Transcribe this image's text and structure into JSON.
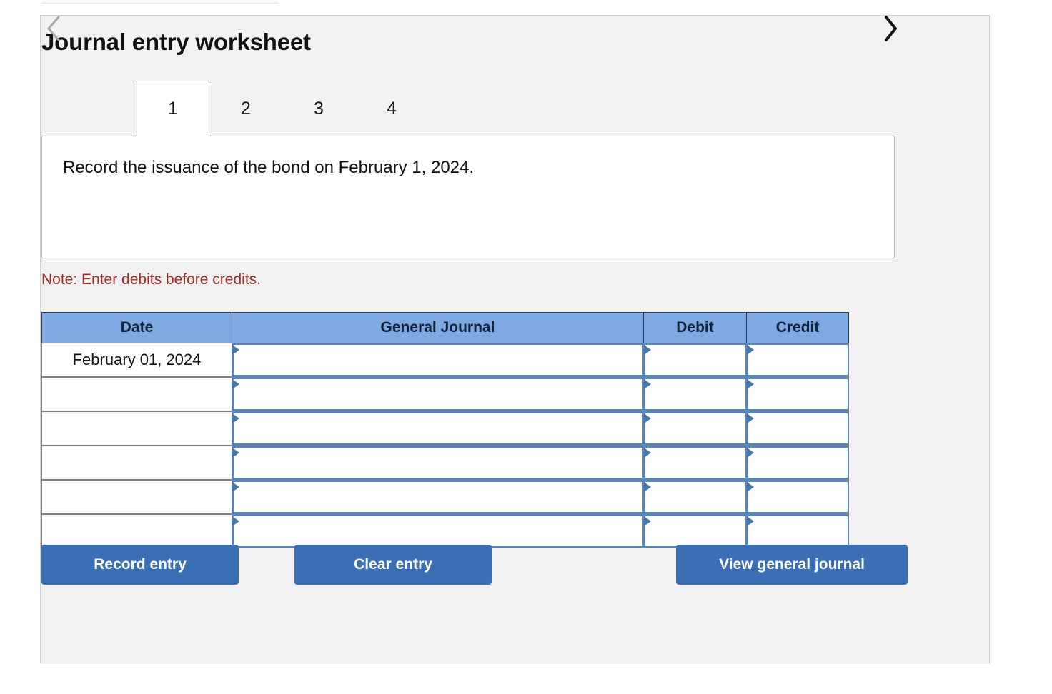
{
  "panel": {
    "title": "Journal entry worksheet"
  },
  "nav": {
    "prev_icon": "chevron-left-icon",
    "next_icon": "chevron-right-icon",
    "prev_color": "#a8a8a8",
    "next_color": "#141414"
  },
  "tabs": {
    "items": [
      {
        "label": "1",
        "active": true
      },
      {
        "label": "2",
        "active": false
      },
      {
        "label": "3",
        "active": false
      },
      {
        "label": "4",
        "active": false
      }
    ]
  },
  "tab_content": {
    "prompt": "Record the issuance of the bond on February 1, 2024."
  },
  "note": {
    "text": "Note: Enter debits before credits.",
    "color": "#a32929"
  },
  "table": {
    "columns": [
      "Date",
      "General Journal",
      "Debit",
      "Credit"
    ],
    "header_bg": "#7fa9e3",
    "rows": [
      {
        "date": "February 01, 2024",
        "general_journal": "",
        "debit": "",
        "credit": ""
      },
      {
        "date": "",
        "general_journal": "",
        "debit": "",
        "credit": ""
      },
      {
        "date": "",
        "general_journal": "",
        "debit": "",
        "credit": ""
      },
      {
        "date": "",
        "general_journal": "",
        "debit": "",
        "credit": ""
      },
      {
        "date": "",
        "general_journal": "",
        "debit": "",
        "credit": ""
      },
      {
        "date": "",
        "general_journal": "",
        "debit": "",
        "credit": ""
      }
    ]
  },
  "buttons": {
    "record": "Record entry",
    "clear": "Clear entry",
    "view": "View general journal",
    "bg": "#3a6fb5"
  }
}
